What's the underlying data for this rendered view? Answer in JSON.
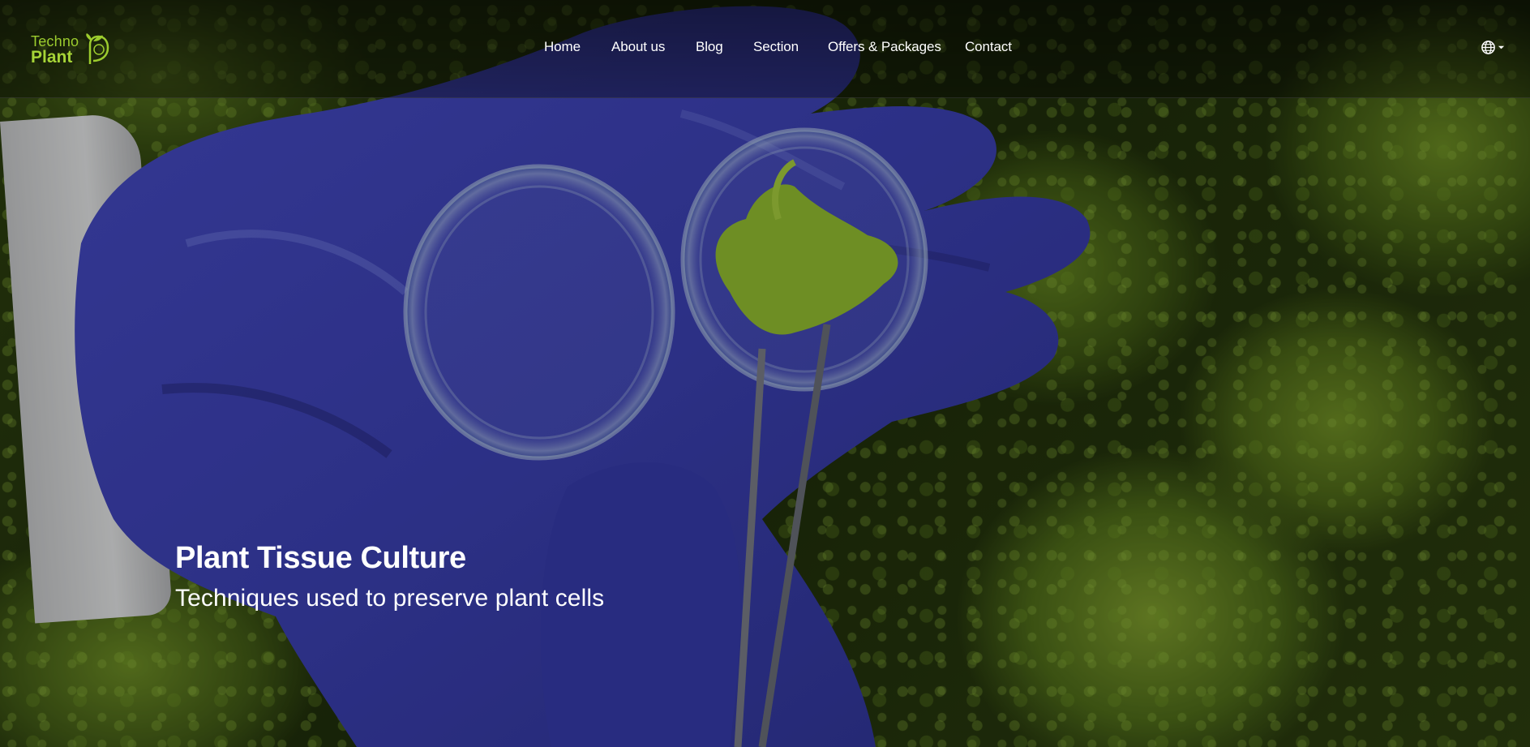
{
  "brand": {
    "logo_line1": "Techno",
    "logo_line2": "Plant",
    "logo_color": "#9ccc2e"
  },
  "nav": {
    "items": [
      {
        "label": "Home"
      },
      {
        "label": "About us"
      },
      {
        "label": "Blog"
      },
      {
        "label": "Section"
      },
      {
        "label": "Offers & Packages"
      },
      {
        "label": "Contact"
      }
    ],
    "language_icon": "globe-icon",
    "language_caret_icon": "caret-down-icon"
  },
  "hero": {
    "title": "Plant Tissue Culture",
    "subtitle": "Techniques used to preserve plant cells",
    "image_subject_icon": "gloved-hand-petri-dish-image"
  },
  "colors": {
    "glove": "#3b3fb8",
    "text": "#ffffff",
    "leaf_green": "#8fb52e"
  }
}
